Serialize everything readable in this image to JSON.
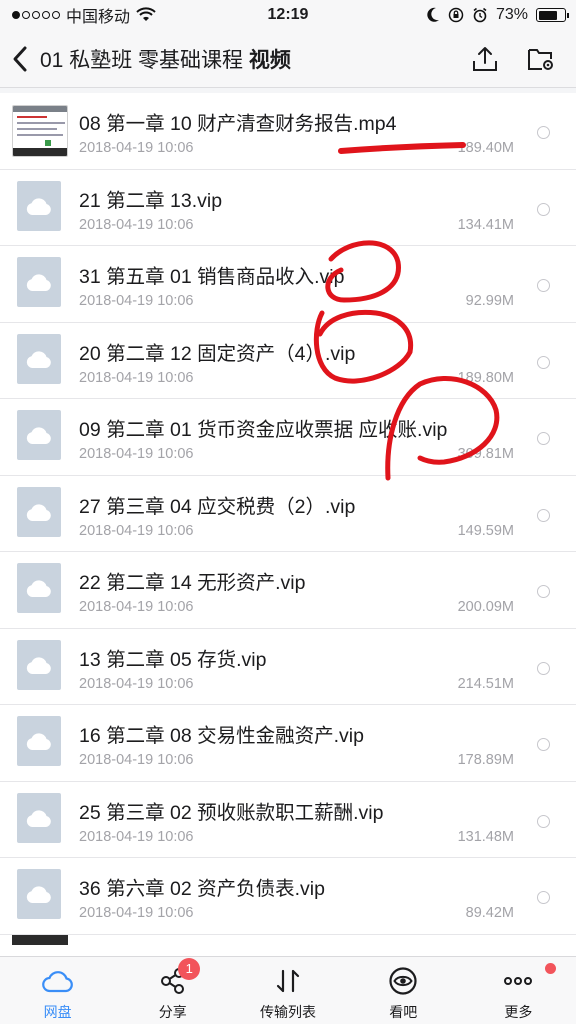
{
  "status_bar": {
    "carrier": "中国移动",
    "time": "12:19",
    "battery": "73%",
    "battery_level": 0.73
  },
  "header": {
    "title_prefix": "01 私塾班 零基础课程",
    "title_bold": "视频",
    "back_icon": "chevron-left-icon",
    "upload_icon": "upload-icon",
    "folder_settings_icon": "folder-settings-icon"
  },
  "files": [
    {
      "name": "08 第一章 10 财产清查财务报告.mp4",
      "date": "2018-04-19 10:06",
      "size": "189.40M",
      "thumb": "video"
    },
    {
      "name": "21 第二章 13.vip",
      "date": "2018-04-19 10:06",
      "size": "134.41M",
      "thumb": "cloud"
    },
    {
      "name": "31 第五章 01 销售商品收入.vip",
      "date": "2018-04-19 10:06",
      "size": "92.99M",
      "thumb": "cloud"
    },
    {
      "name": "20 第二章 12 固定资产（4）.vip",
      "date": "2018-04-19 10:06",
      "size": "189.80M",
      "thumb": "cloud"
    },
    {
      "name": "09 第二章 01 货币资金应收票据 应收账.vip",
      "date": "2018-04-19 10:06",
      "size": "309.81M",
      "thumb": "cloud"
    },
    {
      "name": "27 第三章 04 应交税费（2）.vip",
      "date": "2018-04-19 10:06",
      "size": "149.59M",
      "thumb": "cloud"
    },
    {
      "name": "22 第二章 14 无形资产.vip",
      "date": "2018-04-19 10:06",
      "size": "200.09M",
      "thumb": "cloud"
    },
    {
      "name": "13 第二章 05 存货.vip",
      "date": "2018-04-19 10:06",
      "size": "214.51M",
      "thumb": "cloud"
    },
    {
      "name": "16 第二章 08 交易性金融资产.vip",
      "date": "2018-04-19 10:06",
      "size": "178.89M",
      "thumb": "cloud"
    },
    {
      "name": "25 第三章 02 预收账款职工薪酬.vip",
      "date": "2018-04-19 10:06",
      "size": "131.48M",
      "thumb": "cloud"
    },
    {
      "name": "36 第六章 02 资产负债表.vip",
      "date": "2018-04-19 10:06",
      "size": "89.42M",
      "thumb": "cloud"
    }
  ],
  "tabs": [
    {
      "label": "网盘",
      "icon": "cloud-icon",
      "active": true
    },
    {
      "label": "分享",
      "icon": "share-icon",
      "badge": "1"
    },
    {
      "label": "传输列表",
      "icon": "transfer-icon"
    },
    {
      "label": "看吧",
      "icon": "eye-icon"
    },
    {
      "label": "更多",
      "icon": "more-icon",
      "dot": true
    }
  ],
  "colors": {
    "accent": "#3a8ef7",
    "badge": "#f2545b",
    "annotation": "#e0141b"
  }
}
